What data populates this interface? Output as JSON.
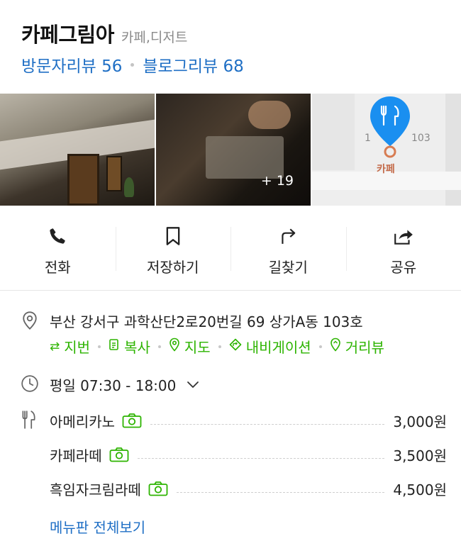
{
  "header": {
    "name": "카페그림아",
    "category": "카페,디저트",
    "visitor_reviews": "방문자리뷰 56",
    "blog_reviews": "블로그리뷰 68"
  },
  "photos": {
    "more_count": "+ 19",
    "map_numbers": [
      "1",
      "103"
    ],
    "map_place_label": "카페"
  },
  "actions": [
    {
      "label": "전화",
      "icon": "phone-icon"
    },
    {
      "label": "저장하기",
      "icon": "bookmark-icon"
    },
    {
      "label": "길찾기",
      "icon": "directions-icon"
    },
    {
      "label": "공유",
      "icon": "share-icon"
    }
  ],
  "address": {
    "text": "부산 강서구 과학산단2로20번길 69 상가A동 103호",
    "links": [
      {
        "label": "지번",
        "icon": "swap-icon"
      },
      {
        "label": "복사",
        "icon": "copy-icon"
      },
      {
        "label": "지도",
        "icon": "map-pin-icon"
      },
      {
        "label": "내비게이션",
        "icon": "car-icon"
      },
      {
        "label": "거리뷰",
        "icon": "street-view-icon"
      }
    ]
  },
  "hours": {
    "text": "평일 07:30 - 18:00"
  },
  "menu": {
    "items": [
      {
        "name": "아메리카노",
        "price": "3,000원"
      },
      {
        "name": "카페라떼",
        "price": "3,500원"
      },
      {
        "name": "흑임자크림라떼",
        "price": "4,500원"
      }
    ],
    "view_all": "메뉴판 전체보기"
  },
  "colors": {
    "link_blue": "#1f6fc5",
    "naver_green": "#2db400",
    "map_marker_blue": "#1a8ff0"
  }
}
